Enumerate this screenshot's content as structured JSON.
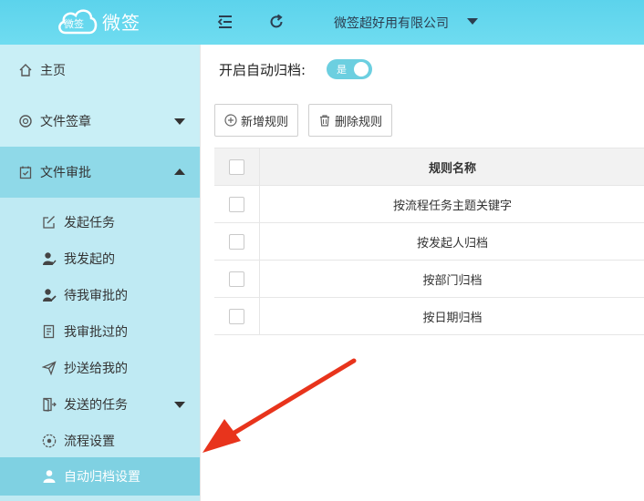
{
  "header": {
    "logo_badge_text": "微签",
    "logo_text": "微签",
    "company_name": "微签超好用有限公司"
  },
  "sidebar": {
    "home": "主页",
    "file_sign": "文件签章",
    "file_approval": "文件审批",
    "submenu": {
      "start_task": "发起任务",
      "my_initiated": "我发起的",
      "pending_approval": "待我审批的",
      "approved": "我审批过的",
      "cc_to_me": "抄送给我的",
      "sent_tasks": "发送的任务",
      "flow_settings": "流程设置",
      "auto_archive": "自动归档设置"
    }
  },
  "main": {
    "archive_label": "开启自动归档:",
    "toggle_text": "是",
    "add_rule": "新增规则",
    "delete_rule": "删除规则",
    "table_header": "规则名称",
    "rules": [
      "按流程任务主题关键字",
      "按发起人归档",
      "按部门归档",
      "按日期归档"
    ]
  },
  "colors": {
    "header": "#5cd3ec",
    "sidebar": "#c9eff6",
    "active": "#7fd1e2",
    "toggle": "#6ccfe0",
    "arrow": "#e8341c"
  }
}
